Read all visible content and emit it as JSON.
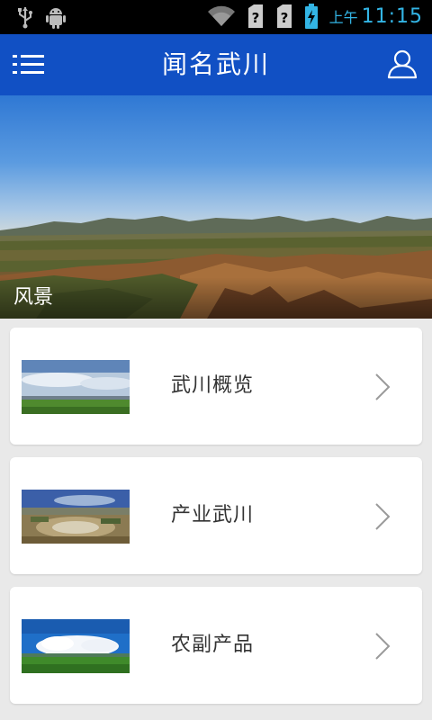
{
  "status_bar": {
    "ampm": "上午",
    "time": "11:15",
    "icons": [
      "usb-icon",
      "android-icon",
      "wifi-icon",
      "sim-unknown-icon",
      "sim-unknown-icon",
      "battery-charging-icon"
    ]
  },
  "header": {
    "title": "闻名武川",
    "menu_icon": "menu-icon",
    "user_icon": "user-icon",
    "background": "#1150c4"
  },
  "hero": {
    "caption": "风景"
  },
  "list": {
    "items": [
      {
        "label": "武川概览",
        "thumb": "grassland-sky-thumbnail"
      },
      {
        "label": "产业武川",
        "thumb": "town-aerial-thumbnail"
      },
      {
        "label": "农副产品",
        "thumb": "pasture-cloud-thumbnail"
      }
    ],
    "chevron_icon": "chevron-right-icon"
  }
}
